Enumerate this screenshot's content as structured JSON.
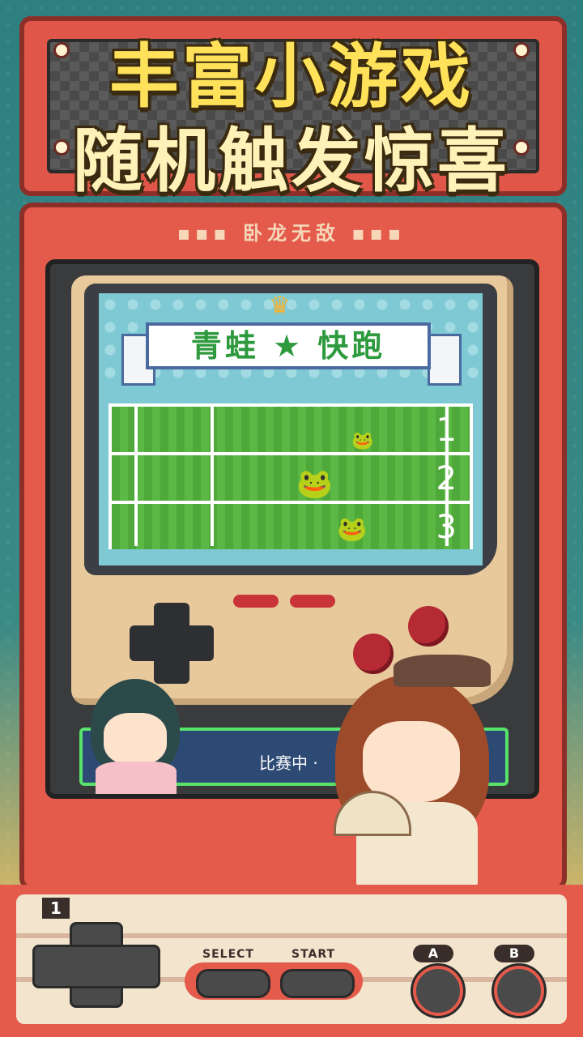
{
  "headline": {
    "line1": "丰富小游戏",
    "line2": "随机触发惊喜"
  },
  "cabinet": {
    "brand": "卧龙无敌"
  },
  "game": {
    "title": "青蛙 ★ 快跑",
    "lanes": [
      {
        "number": "1"
      },
      {
        "number": "2"
      },
      {
        "number": "3"
      }
    ],
    "frogs": [
      "red-frog-icon",
      "yellow-frog-icon",
      "blue-frog-icon"
    ],
    "status": "比赛中 ·"
  },
  "controls": {
    "player_label": "1",
    "select_label": "SELECT",
    "start_label": "START",
    "a_label": "A",
    "b_label": "B"
  },
  "colors": {
    "cabinet_red": "#e45a4b",
    "headline_yellow": "#ffe25a",
    "grass_green": "#4ea83a",
    "screen_blue": "#7ec9d3"
  }
}
